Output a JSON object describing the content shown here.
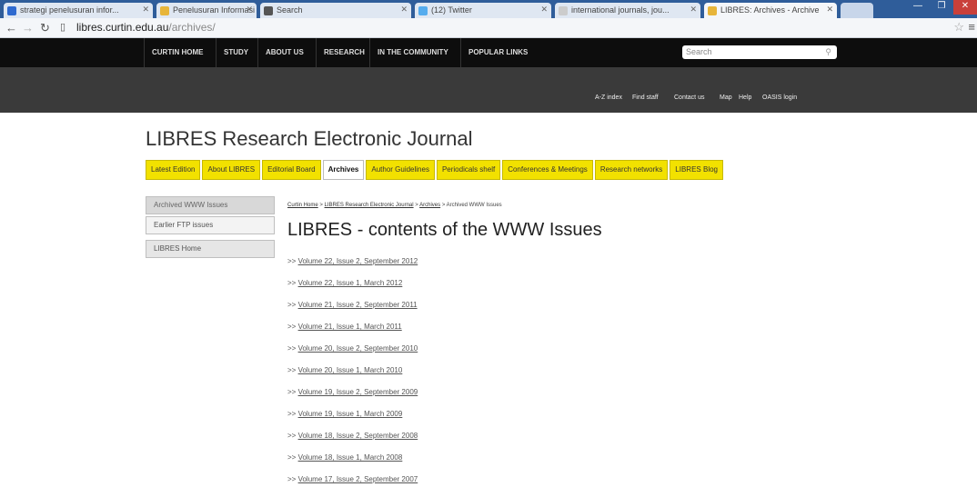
{
  "browser": {
    "tabs": [
      {
        "label": "strategi penelusuran infor...",
        "color": "#2e6ad0"
      },
      {
        "label": "Penelusuran Informasi Ilm...",
        "color": "#e7b53a"
      },
      {
        "label": "Search",
        "color": "#555555"
      },
      {
        "label": "(12) Twitter",
        "color": "#55acee"
      },
      {
        "label": "international journals, jou...",
        "color": "#cccccc"
      },
      {
        "label": "LIBRES: Archives - Archive",
        "color": "#e7b53a"
      }
    ],
    "url_host": "libres.curtin.edu.au",
    "url_path": "/archives/",
    "nav_icons": [
      "back-icon",
      "forward-icon",
      "reload-icon",
      "page-icon"
    ]
  },
  "topnav": {
    "items": [
      "CURTIN HOME",
      "STUDY",
      "ABOUT US",
      "RESEARCH",
      "IN THE COMMUNITY",
      "POPULAR LINKS"
    ],
    "search_placeholder": "Search"
  },
  "subnav": {
    "items": [
      "A-Z index",
      "Find staff",
      "Contact us",
      "Map",
      "Help",
      "OASIS login"
    ]
  },
  "site_title": "LIBRES Research Electronic Journal",
  "tabs": [
    "Latest Edition",
    "About LIBRES",
    "Editorial Board",
    "Archives",
    "Author Guidelines",
    "Periodicals shelf",
    "Conferences & Meetings",
    "Research networks",
    "LIBRES Blog"
  ],
  "tab_colors": {
    "active": "#ffffff",
    "inactive": "#f2e100"
  },
  "sidebar": [
    "Archived WWW Issues",
    "Earlier FTP issues",
    "LIBRES Home"
  ],
  "breadcrumb": {
    "links": [
      "Curtin Home",
      "LIBRES Research Electronic Journal",
      "Archives"
    ],
    "current": "Archived WWW Issues",
    "separator": ">"
  },
  "heading": "LIBRES - contents of the WWW Issues",
  "issue_prefix": ">>",
  "issues": [
    "Volume 22, Issue 2, September 2012",
    "Volume 22, Issue 1, March 2012",
    "Volume 21, Issue 2, September 2011",
    "Volume 21, Issue 1, March 2011",
    "Volume 20, Issue 2, September 2010",
    "Volume 20, Issue 1, March 2010",
    "Volume 19, Issue 2, September 2009",
    "Volume 19, Issue 1, March 2009",
    "Volume 18, Issue 2, September 2008",
    "Volume 18, Issue 1, March 2008",
    "Volume 17, Issue 2, September 2007"
  ]
}
